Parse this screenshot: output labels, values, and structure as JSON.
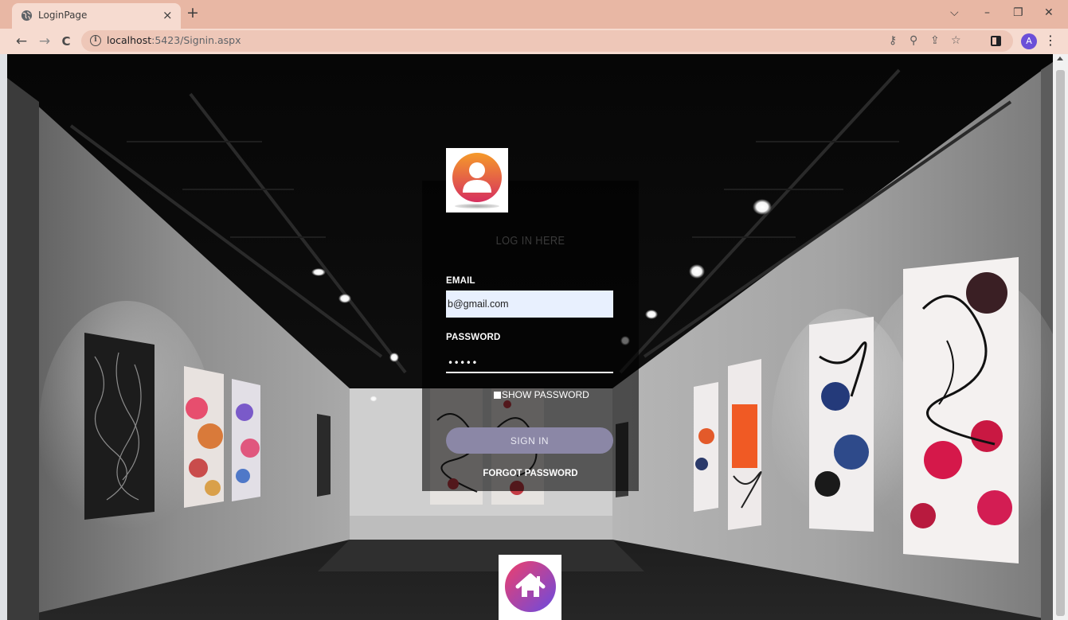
{
  "browser": {
    "tab_title": "LoginPage",
    "tab_close": "×",
    "new_tab": "+",
    "url_host": "localhost",
    "url_rest": ":5423/Signin.aspx",
    "profile_initial": "A",
    "window_controls": {
      "tab_search": "⌵",
      "minimize": "–",
      "restore": "❐",
      "close": "✕"
    },
    "nav": {
      "back": "←",
      "forward": "→",
      "reload": "C"
    },
    "toolbar_icons": {
      "key": "⚷",
      "zoom": "⚲",
      "share": "⇪",
      "star": "☆",
      "menu": "⋮"
    }
  },
  "login": {
    "heading": "LOG IN HERE",
    "email_label": "EMAIL",
    "email_value": "b@gmail.com",
    "password_label": "PASSWORD",
    "password_value": "•••••",
    "show_password": "SHOW PASSWORD",
    "sign_in": "SIGN IN",
    "forgot_password": "FORGOT PASSWORD"
  },
  "icons": {
    "user_avatar": "user-avatar-icon",
    "home": "home-icon"
  },
  "colors": {
    "chrome_tabstrip": "#e8b7a4",
    "chrome_toolbar": "#f6dbd0",
    "signin_button": "#8b87a6",
    "email_field": "#e8f0fe",
    "avatar_gradient_start": "#f59a2a",
    "avatar_gradient_end": "#d6305f",
    "home_gradient_start": "#ef3f6b",
    "home_gradient_end": "#6a4be0"
  }
}
